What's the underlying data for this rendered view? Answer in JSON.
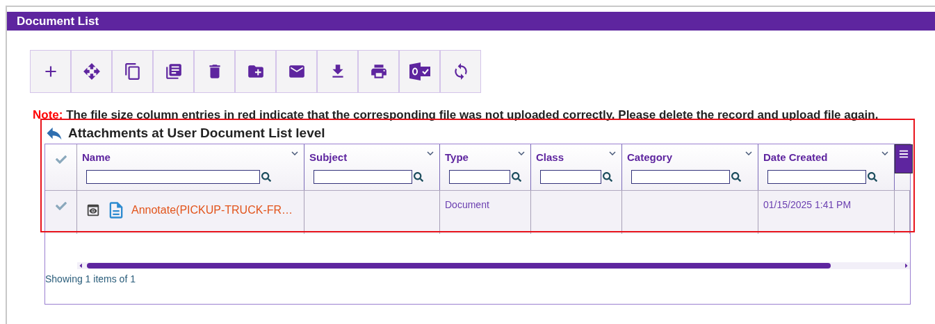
{
  "window": {
    "title": "Document List"
  },
  "note": {
    "label": "Note:",
    "text": "The file size column entries in red indicate that the corresponding file was not uploaded correctly. Please delete the record and upload file again."
  },
  "grid": {
    "title": "Attachments at User Document List level",
    "highlighted": true,
    "columns": [
      {
        "label": "Name"
      },
      {
        "label": "Subject"
      },
      {
        "label": "Type"
      },
      {
        "label": "Class"
      },
      {
        "label": "Category"
      },
      {
        "label": "Date Created"
      }
    ],
    "rows": [
      {
        "selected": false,
        "cells": [
          "Annotate(PICKUP-TRUCK-FR…",
          "",
          "Document",
          "",
          "",
          "01/15/2025 1:41 PM"
        ]
      }
    ],
    "footer": "Showing 1 items of 1"
  }
}
